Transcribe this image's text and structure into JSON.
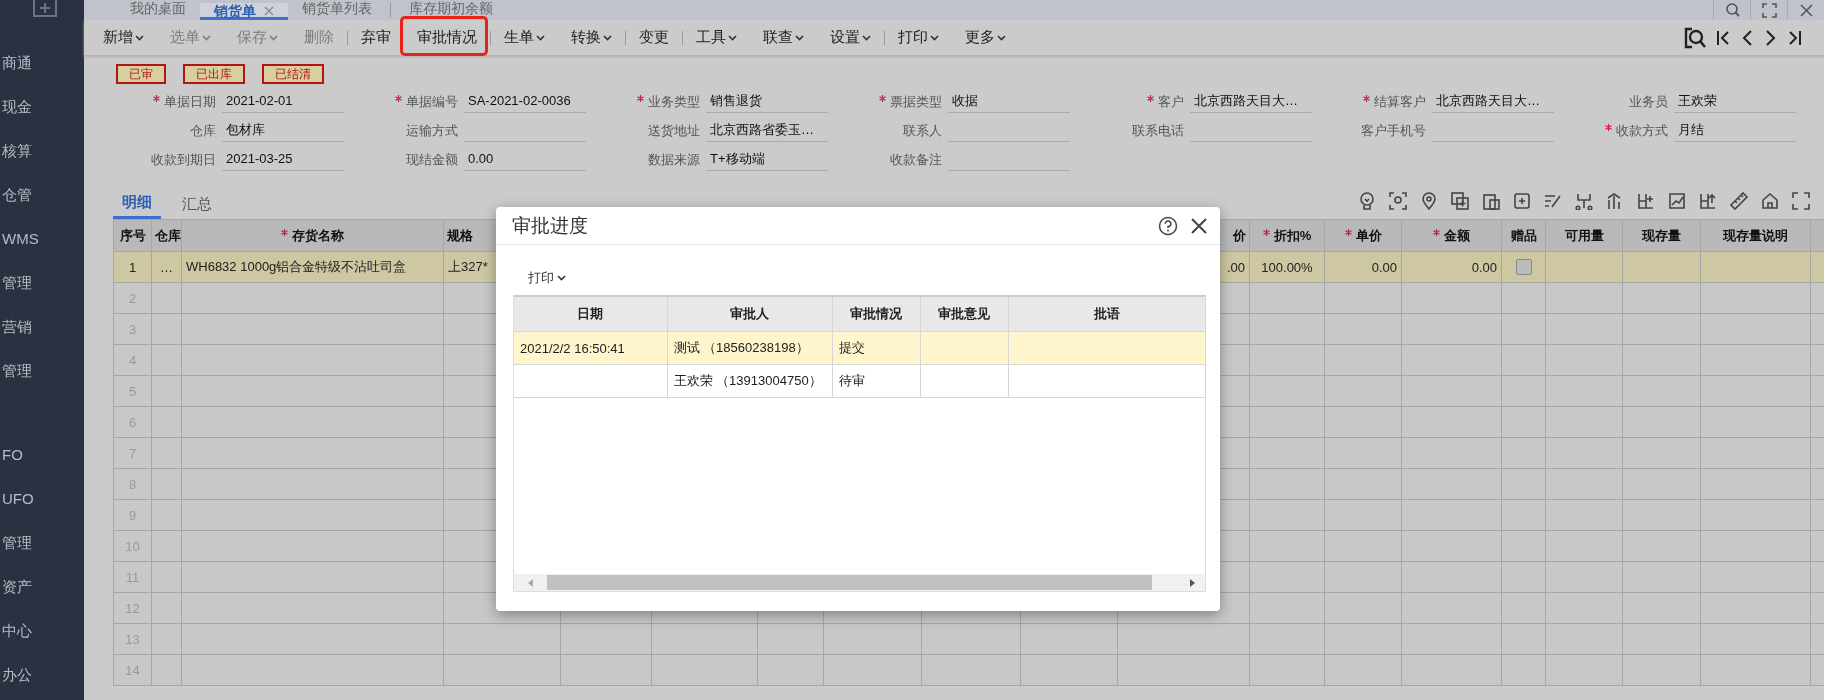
{
  "sidebar": {
    "sections": [
      {
        "items": [
          "商通",
          "现金",
          "核算",
          "仓管",
          "WMS",
          "管理",
          "营销",
          "管理"
        ]
      },
      {
        "items": [
          "FO",
          "UFO",
          "管理",
          "资产",
          "中心",
          "办公"
        ]
      }
    ]
  },
  "tabs": [
    {
      "label": "我的桌面",
      "selected": false,
      "closable": false
    },
    {
      "label": "销货单",
      "selected": true,
      "closable": true
    },
    {
      "label": "销货单列表",
      "selected": false,
      "closable": false
    },
    {
      "label": "库存期初余额",
      "selected": false,
      "closable": false
    }
  ],
  "toolbar": [
    {
      "label": "新增",
      "caret": true,
      "disabled": false,
      "separator_after": false
    },
    {
      "label": "选单",
      "caret": true,
      "disabled": true,
      "separator_after": false
    },
    {
      "label": "保存",
      "caret": true,
      "disabled": true,
      "separator_after": false
    },
    {
      "label": "删除",
      "caret": false,
      "disabled": true,
      "separator_after": true
    },
    {
      "label": "弃审",
      "caret": false,
      "disabled": false,
      "separator_after": false
    },
    {
      "label": "审批情况",
      "caret": false,
      "disabled": false,
      "separator_after": true,
      "highlighted": true
    },
    {
      "label": "生单",
      "caret": true,
      "disabled": false,
      "separator_after": false
    },
    {
      "label": "转换",
      "caret": true,
      "disabled": false,
      "separator_after": true
    },
    {
      "label": "变更",
      "caret": false,
      "disabled": false,
      "separator_after": true
    },
    {
      "label": "工具",
      "caret": true,
      "disabled": false,
      "separator_after": false
    },
    {
      "label": "联查",
      "caret": true,
      "disabled": false,
      "separator_after": false
    },
    {
      "label": "设置",
      "caret": true,
      "disabled": false,
      "separator_after": true
    },
    {
      "label": "打印",
      "caret": true,
      "disabled": false,
      "separator_after": false
    },
    {
      "label": "更多",
      "caret": true,
      "disabled": false,
      "separator_after": false
    }
  ],
  "stamps": [
    "已审",
    "已出库",
    "已结清"
  ],
  "form": {
    "rows": [
      [
        {
          "label": "单据日期",
          "required": true,
          "value": "2021-02-01"
        },
        {
          "label": "单据编号",
          "required": true,
          "value": "SA-2021-02-0036"
        },
        {
          "label": "业务类型",
          "required": true,
          "value": "销售退货"
        },
        {
          "label": "票据类型",
          "required": true,
          "value": "收据"
        },
        {
          "label": "客户",
          "required": true,
          "value": "北京西路天目大…"
        },
        {
          "label": "结算客户",
          "required": true,
          "value": "北京西路天目大…"
        },
        {
          "label": "业务员",
          "required": false,
          "value": "王欢荣"
        }
      ],
      [
        {
          "label": "仓库",
          "required": false,
          "value": "包材库"
        },
        {
          "label": "运输方式",
          "required": false
        },
        {
          "label": "送货地址",
          "required": false,
          "value": "北京西路省委玉…"
        },
        {
          "label": "联系人",
          "required": false
        },
        {
          "label": "联系电话",
          "required": false
        },
        {
          "label": "客户手机号",
          "required": false
        },
        {
          "label": "收款方式",
          "required": true,
          "value": "月结"
        }
      ],
      [
        {
          "label": "收款到期日",
          "required": false,
          "value": "2021-03-25"
        },
        {
          "label": "现结金额",
          "required": false,
          "value": "0.00"
        },
        {
          "label": "数据来源",
          "required": false,
          "value": "T+移动端"
        },
        {
          "label": "收款备注",
          "required": false
        }
      ]
    ]
  },
  "detail_tabs": [
    {
      "label": "明细",
      "selected": true
    },
    {
      "label": "汇总",
      "selected": false
    }
  ],
  "table": {
    "columns": [
      {
        "label": "序号",
        "required": false
      },
      {
        "label": "仓库",
        "required": false
      },
      {
        "label": "存货名称",
        "required": true
      },
      {
        "label": "规格",
        "required": false
      },
      {},
      {},
      {},
      {},
      {},
      {},
      {
        "label": "价",
        "required": false
      },
      {
        "label": "折扣%",
        "required": true
      },
      {
        "label": "单价",
        "required": true
      },
      {
        "label": "金额",
        "required": true
      },
      {
        "label": "赠品",
        "required": false
      },
      {
        "label": "可用量",
        "required": false
      },
      {
        "label": "现存量",
        "required": false
      },
      {
        "label": "现存量说明",
        "required": false
      },
      {}
    ],
    "rows": [
      {
        "selected": true,
        "number": "1",
        "warehouse": "…",
        "item_name": "WH6832 1000g铝合金特级不沾吐司盒",
        "spec": "上327*",
        "price": ".00",
        "discount": "100.00%",
        "unit_price": "0.00",
        "amount": "0.00",
        "gift_checked": false
      },
      {
        "selected": false,
        "number": "2"
      },
      {
        "selected": false,
        "number": "3"
      },
      {
        "selected": false,
        "number": "4"
      },
      {
        "selected": false,
        "number": "5"
      },
      {
        "selected": false,
        "number": "6"
      },
      {
        "selected": false,
        "number": "7"
      },
      {
        "selected": false,
        "number": "8"
      },
      {
        "selected": false,
        "number": "9"
      },
      {
        "selected": false,
        "number": "10"
      },
      {
        "selected": false,
        "number": "11"
      },
      {
        "selected": false,
        "number": "12"
      },
      {
        "selected": false,
        "number": "13"
      },
      {
        "selected": false,
        "number": "14"
      }
    ]
  },
  "dialog": {
    "title": "审批进度",
    "print_button": "打印",
    "columns": [
      "日期",
      "审批人",
      "审批情况",
      "审批意见",
      "批语"
    ],
    "rows": [
      {
        "selected": true,
        "date": "2021/2/2 16:50:41",
        "approver": "测试 （18560238198）",
        "status": "提交"
      },
      {
        "selected": false,
        "approver": "王欢荣 （13913004750）",
        "status": "待审"
      }
    ]
  }
}
